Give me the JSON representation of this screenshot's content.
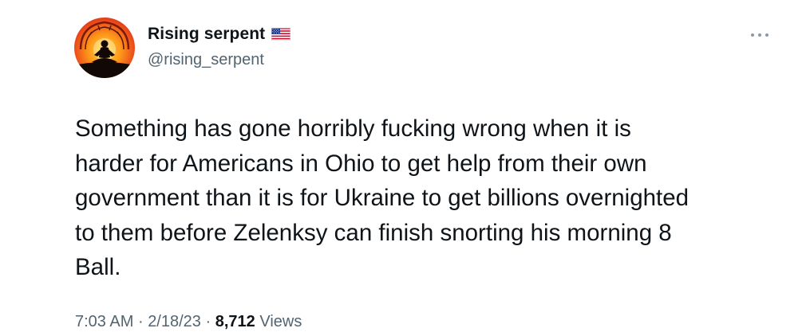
{
  "tweet": {
    "author": {
      "display_name": "Rising serpent",
      "flag_icon": "us-flag-icon",
      "handle": "@rising_serpent",
      "avatar_icon": "meditating-figure-avatar"
    },
    "more_icon": "more-options-icon",
    "text": "Something has gone horribly fucking wrong when it is\nharder for Americans in Ohio to get help from their own\ngovernment than it is for Ukraine to get billions overnighted\nto them before Zelenksy can finish snorting his morning 8\nBall.",
    "meta": {
      "time": "7:03 AM",
      "separator": "·",
      "date": "2/18/23",
      "views_count": "8,712",
      "views_label": "Views"
    }
  },
  "colors": {
    "text_primary": "#0f1419",
    "text_secondary": "#536471"
  }
}
